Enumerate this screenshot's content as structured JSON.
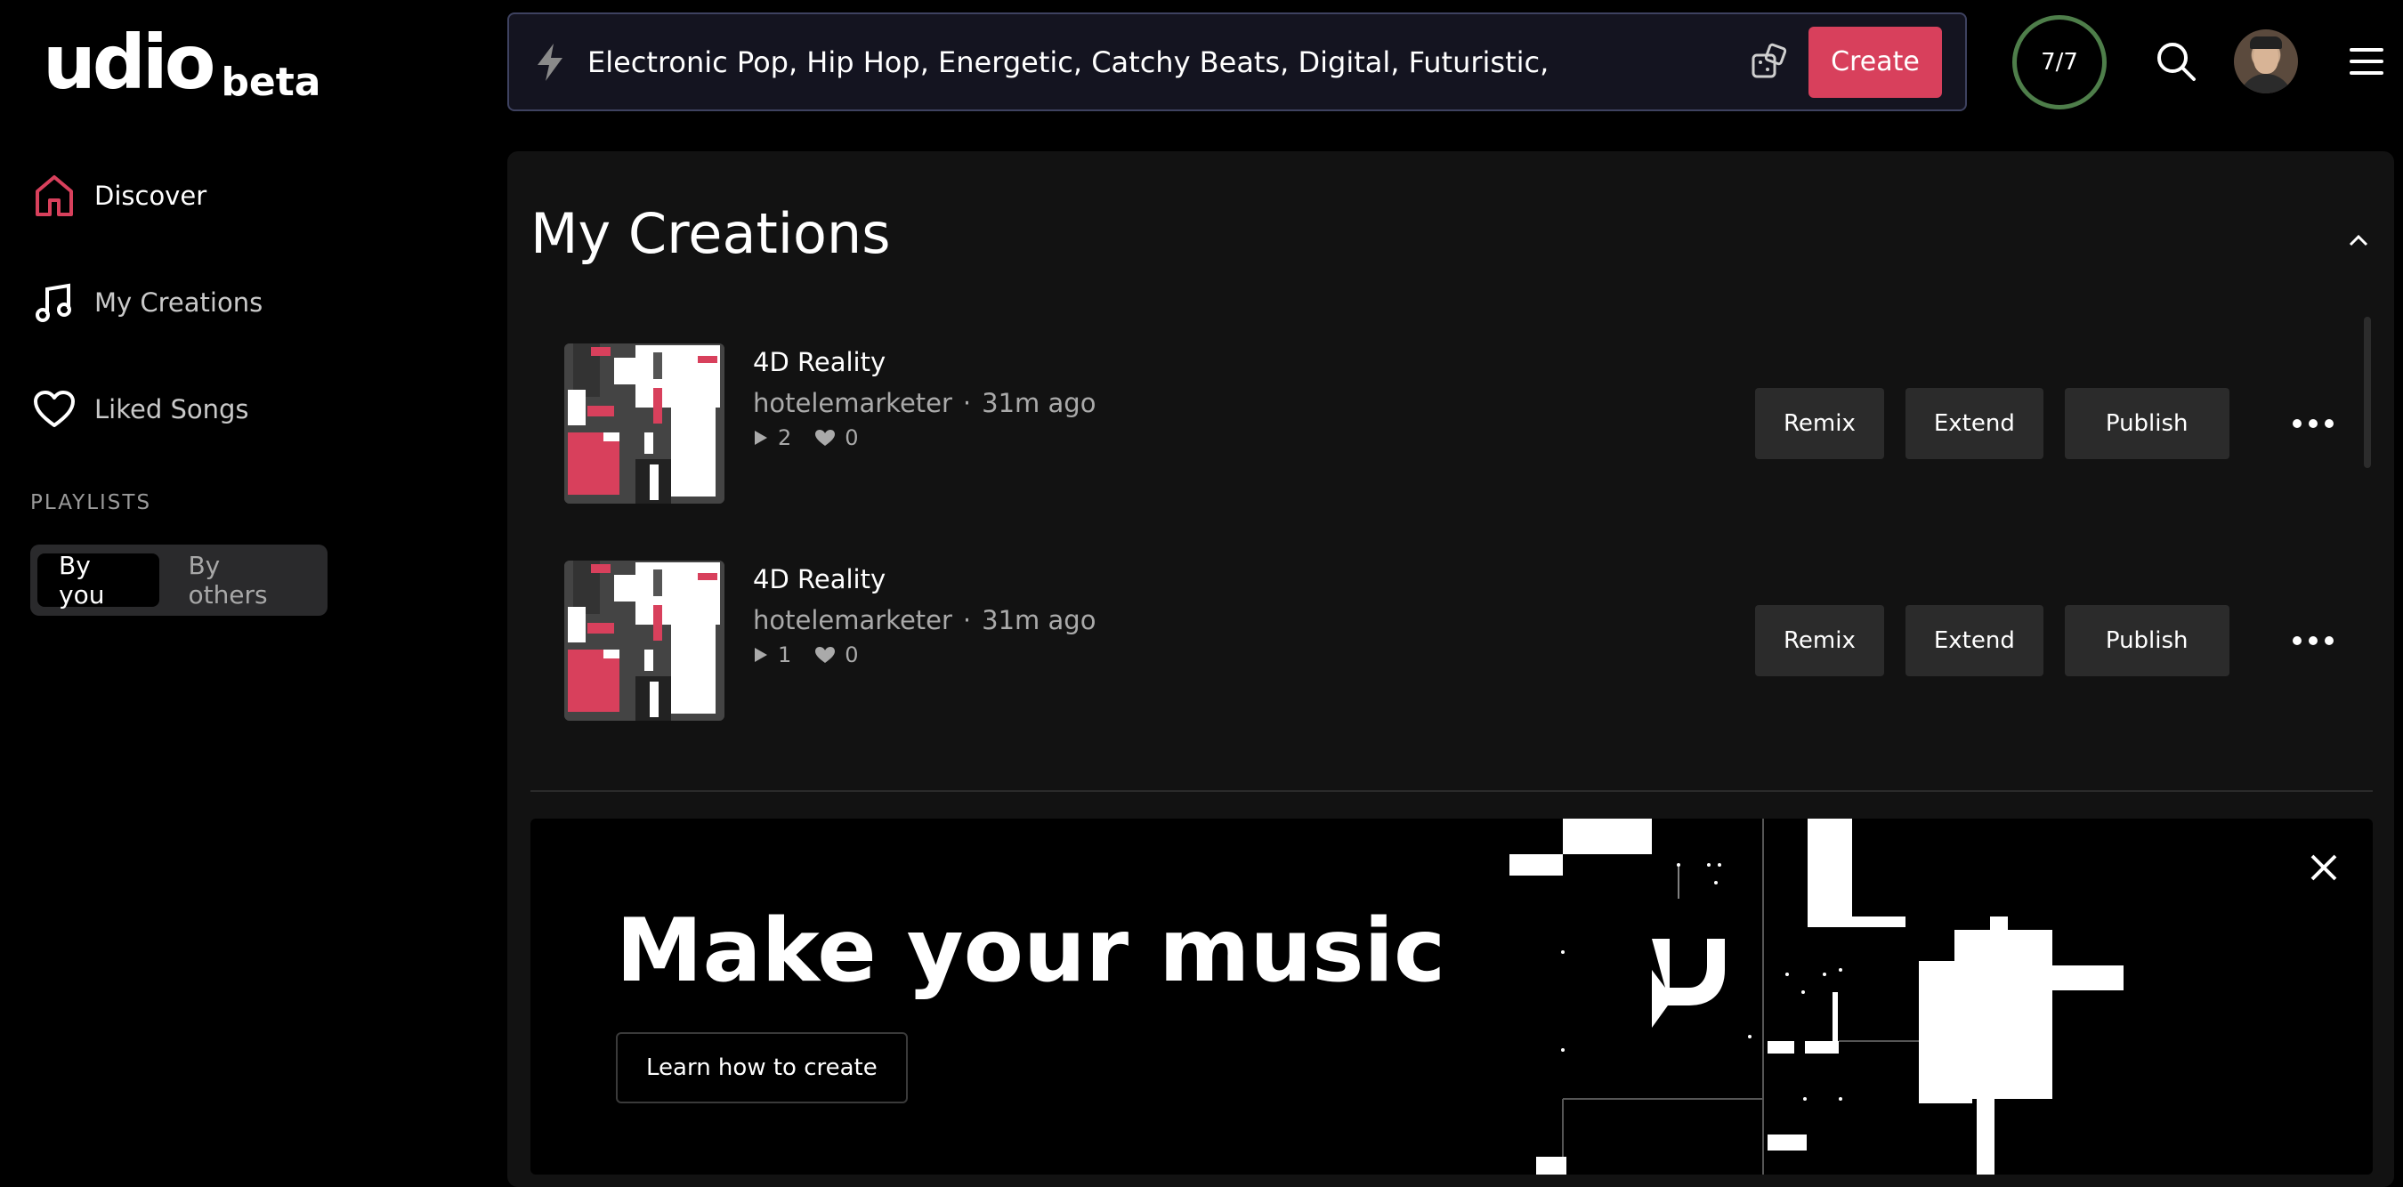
{
  "brand": {
    "logo_text": "udio",
    "badge": "beta"
  },
  "sidebar": {
    "items": [
      {
        "label": "Discover",
        "icon": "home-icon",
        "active": true
      },
      {
        "label": "My Creations",
        "icon": "music-note-icon",
        "active": false
      },
      {
        "label": "Liked Songs",
        "icon": "heart-icon",
        "active": false
      }
    ],
    "playlists_heading": "PLAYLISTS",
    "playlist_tabs": [
      "By you",
      "By others"
    ],
    "playlist_tab_selected": "By you"
  },
  "topbar": {
    "prompt_value": "Electronic Pop, Hip Hop, Energetic, Catchy Beats, Digital, Futuristic,",
    "create_label": "Create",
    "credits": "7/7"
  },
  "main": {
    "section_title": "My Creations",
    "songs": [
      {
        "title": "4D Reality",
        "author": "hotelemarketer",
        "time": "31m ago",
        "plays": "2",
        "likes": "0"
      },
      {
        "title": "4D Reality",
        "author": "hotelemarketer",
        "time": "31m ago",
        "plays": "1",
        "likes": "0"
      }
    ],
    "actions": {
      "remix": "Remix",
      "extend": "Extend",
      "publish": "Publish"
    }
  },
  "banner": {
    "headline": "Make your music",
    "button_label": "Learn how to create"
  },
  "colors": {
    "accent": "#d8405c",
    "credits_ring": "#4e7e4a",
    "prompt_border": "#3e4260"
  }
}
